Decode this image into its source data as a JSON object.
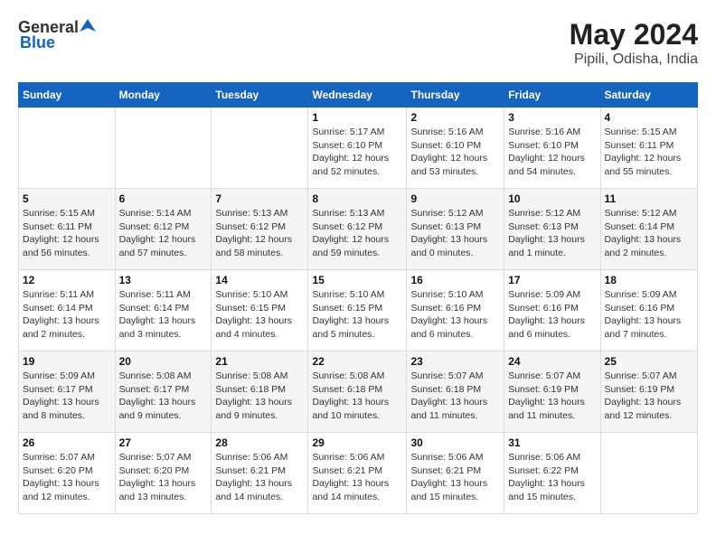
{
  "header": {
    "logo_general": "General",
    "logo_blue": "Blue",
    "month": "May 2024",
    "location": "Pipili, Odisha, India"
  },
  "days_of_week": [
    "Sunday",
    "Monday",
    "Tuesday",
    "Wednesday",
    "Thursday",
    "Friday",
    "Saturday"
  ],
  "weeks": [
    [
      {
        "day": "",
        "info": ""
      },
      {
        "day": "",
        "info": ""
      },
      {
        "day": "",
        "info": ""
      },
      {
        "day": "1",
        "info": "Sunrise: 5:17 AM\nSunset: 6:10 PM\nDaylight: 12 hours and 52 minutes."
      },
      {
        "day": "2",
        "info": "Sunrise: 5:16 AM\nSunset: 6:10 PM\nDaylight: 12 hours and 53 minutes."
      },
      {
        "day": "3",
        "info": "Sunrise: 5:16 AM\nSunset: 6:10 PM\nDaylight: 12 hours and 54 minutes."
      },
      {
        "day": "4",
        "info": "Sunrise: 5:15 AM\nSunset: 6:11 PM\nDaylight: 12 hours and 55 minutes."
      }
    ],
    [
      {
        "day": "5",
        "info": "Sunrise: 5:15 AM\nSunset: 6:11 PM\nDaylight: 12 hours and 56 minutes."
      },
      {
        "day": "6",
        "info": "Sunrise: 5:14 AM\nSunset: 6:12 PM\nDaylight: 12 hours and 57 minutes."
      },
      {
        "day": "7",
        "info": "Sunrise: 5:13 AM\nSunset: 6:12 PM\nDaylight: 12 hours and 58 minutes."
      },
      {
        "day": "8",
        "info": "Sunrise: 5:13 AM\nSunset: 6:12 PM\nDaylight: 12 hours and 59 minutes."
      },
      {
        "day": "9",
        "info": "Sunrise: 5:12 AM\nSunset: 6:13 PM\nDaylight: 13 hours and 0 minutes."
      },
      {
        "day": "10",
        "info": "Sunrise: 5:12 AM\nSunset: 6:13 PM\nDaylight: 13 hours and 1 minute."
      },
      {
        "day": "11",
        "info": "Sunrise: 5:12 AM\nSunset: 6:14 PM\nDaylight: 13 hours and 2 minutes."
      }
    ],
    [
      {
        "day": "12",
        "info": "Sunrise: 5:11 AM\nSunset: 6:14 PM\nDaylight: 13 hours and 2 minutes."
      },
      {
        "day": "13",
        "info": "Sunrise: 5:11 AM\nSunset: 6:14 PM\nDaylight: 13 hours and 3 minutes."
      },
      {
        "day": "14",
        "info": "Sunrise: 5:10 AM\nSunset: 6:15 PM\nDaylight: 13 hours and 4 minutes."
      },
      {
        "day": "15",
        "info": "Sunrise: 5:10 AM\nSunset: 6:15 PM\nDaylight: 13 hours and 5 minutes."
      },
      {
        "day": "16",
        "info": "Sunrise: 5:10 AM\nSunset: 6:16 PM\nDaylight: 13 hours and 6 minutes."
      },
      {
        "day": "17",
        "info": "Sunrise: 5:09 AM\nSunset: 6:16 PM\nDaylight: 13 hours and 6 minutes."
      },
      {
        "day": "18",
        "info": "Sunrise: 5:09 AM\nSunset: 6:16 PM\nDaylight: 13 hours and 7 minutes."
      }
    ],
    [
      {
        "day": "19",
        "info": "Sunrise: 5:09 AM\nSunset: 6:17 PM\nDaylight: 13 hours and 8 minutes."
      },
      {
        "day": "20",
        "info": "Sunrise: 5:08 AM\nSunset: 6:17 PM\nDaylight: 13 hours and 9 minutes."
      },
      {
        "day": "21",
        "info": "Sunrise: 5:08 AM\nSunset: 6:18 PM\nDaylight: 13 hours and 9 minutes."
      },
      {
        "day": "22",
        "info": "Sunrise: 5:08 AM\nSunset: 6:18 PM\nDaylight: 13 hours and 10 minutes."
      },
      {
        "day": "23",
        "info": "Sunrise: 5:07 AM\nSunset: 6:18 PM\nDaylight: 13 hours and 11 minutes."
      },
      {
        "day": "24",
        "info": "Sunrise: 5:07 AM\nSunset: 6:19 PM\nDaylight: 13 hours and 11 minutes."
      },
      {
        "day": "25",
        "info": "Sunrise: 5:07 AM\nSunset: 6:19 PM\nDaylight: 13 hours and 12 minutes."
      }
    ],
    [
      {
        "day": "26",
        "info": "Sunrise: 5:07 AM\nSunset: 6:20 PM\nDaylight: 13 hours and 12 minutes."
      },
      {
        "day": "27",
        "info": "Sunrise: 5:07 AM\nSunset: 6:20 PM\nDaylight: 13 hours and 13 minutes."
      },
      {
        "day": "28",
        "info": "Sunrise: 5:06 AM\nSunset: 6:21 PM\nDaylight: 13 hours and 14 minutes."
      },
      {
        "day": "29",
        "info": "Sunrise: 5:06 AM\nSunset: 6:21 PM\nDaylight: 13 hours and 14 minutes."
      },
      {
        "day": "30",
        "info": "Sunrise: 5:06 AM\nSunset: 6:21 PM\nDaylight: 13 hours and 15 minutes."
      },
      {
        "day": "31",
        "info": "Sunrise: 5:06 AM\nSunset: 6:22 PM\nDaylight: 13 hours and 15 minutes."
      },
      {
        "day": "",
        "info": ""
      }
    ]
  ]
}
